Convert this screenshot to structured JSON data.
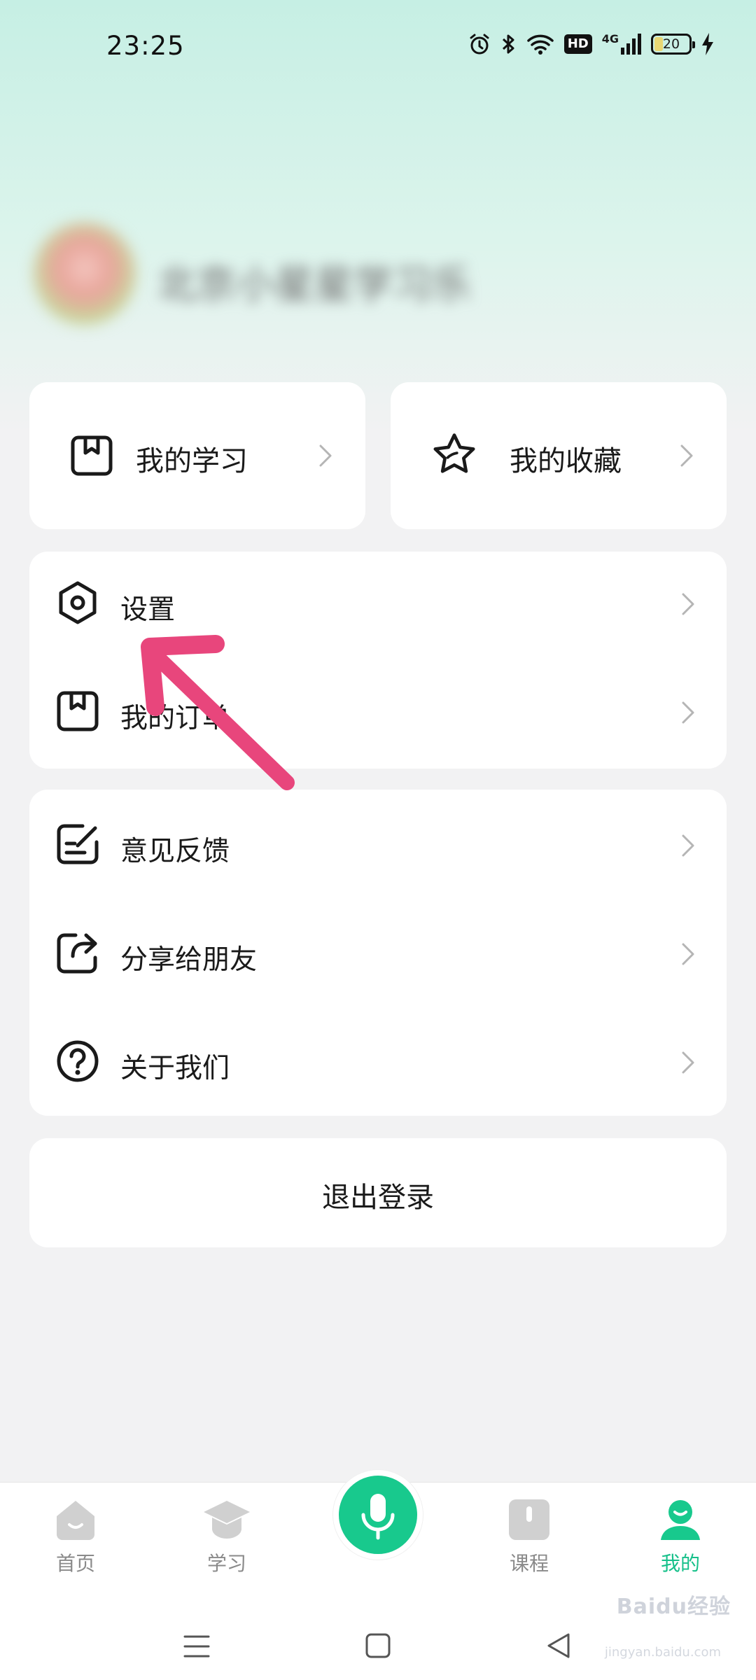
{
  "status_bar": {
    "time": "23:25",
    "hd_label": "HD",
    "network_label": "4G",
    "battery_level": "20",
    "icons": [
      "alarm-icon",
      "bluetooth-icon",
      "wifi-icon",
      "hd-badge",
      "signal-4g-icon",
      "battery-icon",
      "charging-icon"
    ]
  },
  "profile": {
    "username_blurred": "北京小星星学习乐园"
  },
  "quick_cards": [
    {
      "label": "我的学习",
      "icon": "bookmark-book-icon"
    },
    {
      "label": "我的收藏",
      "icon": "star-icon"
    }
  ],
  "menu_group_1": [
    {
      "label": "设置",
      "icon": "settings-hexagon-icon"
    },
    {
      "label": "我的订单",
      "icon": "order-icon"
    }
  ],
  "menu_group_2": [
    {
      "label": "意见反馈",
      "icon": "feedback-edit-icon"
    },
    {
      "label": "分享给朋友",
      "icon": "share-icon"
    },
    {
      "label": "关于我们",
      "icon": "question-circle-icon"
    }
  ],
  "logout": {
    "label": "退出登录"
  },
  "bottom_nav": {
    "items": [
      {
        "label": "首页",
        "icon": "home-icon",
        "active": false
      },
      {
        "label": "学习",
        "icon": "graduation-cap-icon",
        "active": false
      },
      {
        "label": "",
        "icon": "microphone-icon",
        "active": false
      },
      {
        "label": "课程",
        "icon": "book-icon",
        "active": false
      },
      {
        "label": "我的",
        "icon": "profile-icon",
        "active": true
      }
    ]
  },
  "watermark": {
    "text": "Baidu经验",
    "url_text": "jingyan.baidu.com"
  },
  "colors": {
    "accent": "#18c98d",
    "active_tab": "#16c08a",
    "annotation_arrow": "#e8467c",
    "background": "#f2f2f3",
    "header_gradient_top": "#c6efe4"
  }
}
